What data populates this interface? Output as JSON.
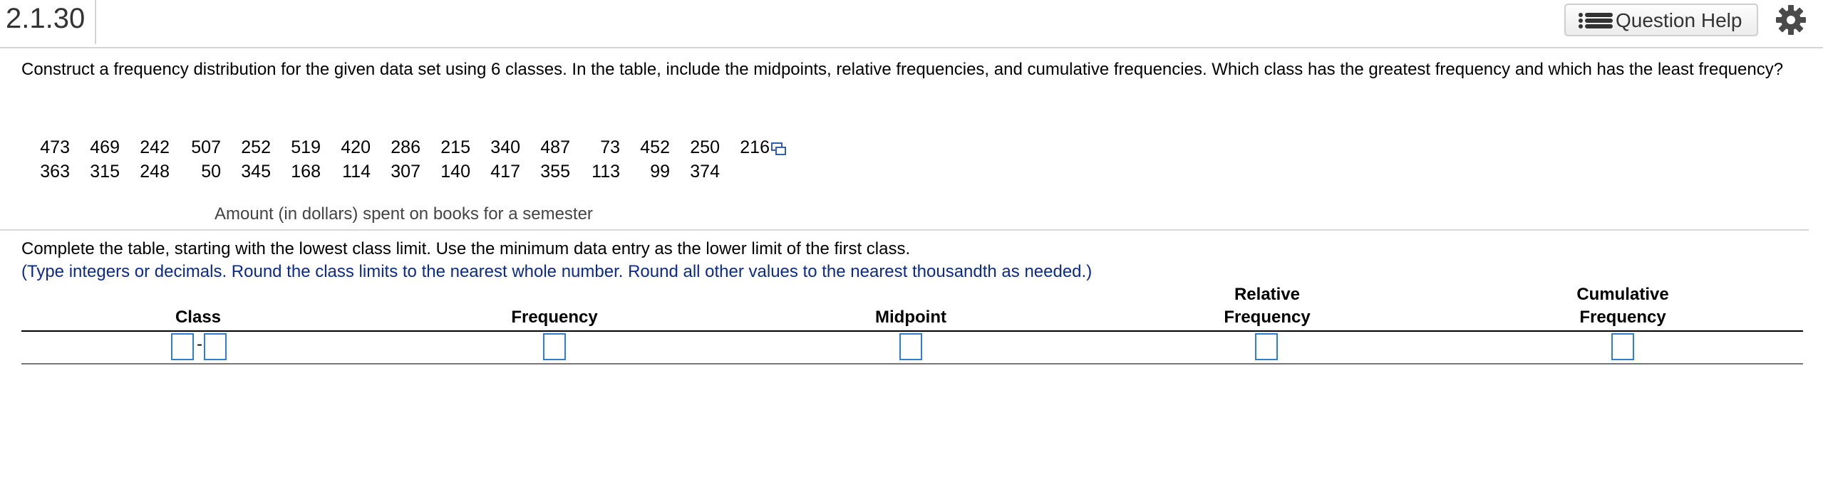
{
  "header": {
    "question_number": "2.1.30",
    "help_label": "Question Help",
    "help_icon": "list-icon",
    "settings_icon": "gear-icon"
  },
  "prompt": "Construct a frequency distribution for the given data set using 6 classes. In the table, include the midpoints, relative frequencies, and cumulative frequencies. Which class has the greatest frequency and which has the least frequency?",
  "data_rows": [
    [
      "473",
      "469",
      "242",
      "507",
      "252",
      "519",
      "420",
      "286",
      "215",
      "340",
      "487",
      "73",
      "452",
      "250",
      "216"
    ],
    [
      "363",
      "315",
      "248",
      "50",
      "345",
      "168",
      "114",
      "307",
      "140",
      "417",
      "355",
      "113",
      "99",
      "374"
    ]
  ],
  "data_caption": "Amount (in dollars) spent on books for a semester",
  "instructions": "Complete the table, starting with the lowest class limit. Use the minimum data entry as the lower limit of the first class.",
  "note": "(Type integers or decimals. Round the class limits to the nearest whole number. Round all other values to the nearest thousandth as needed.)",
  "table": {
    "headers": {
      "class": "Class",
      "frequency": "Frequency",
      "midpoint": "Midpoint",
      "relative_line1": "Relative",
      "relative_line2": "Frequency",
      "cumulative_line1": "Cumulative",
      "cumulative_line2": "Frequency"
    },
    "class_separator": "-",
    "inputs": {
      "class_lower": "",
      "class_upper": "",
      "frequency": "",
      "midpoint": "",
      "relative_frequency": "",
      "cumulative_frequency": ""
    }
  }
}
